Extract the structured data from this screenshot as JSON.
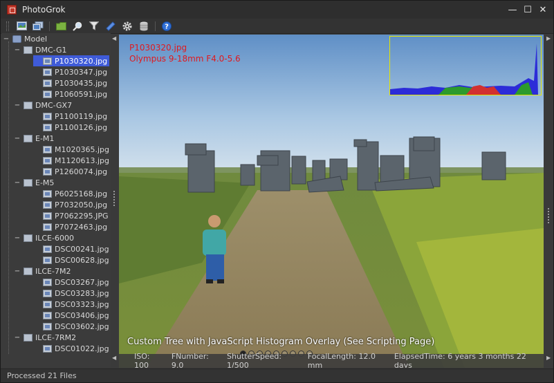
{
  "window": {
    "title": "PhotoGrok",
    "minimize_label": "—",
    "maximize_label": "☐",
    "close_label": "✕"
  },
  "toolbar": {
    "buttons": [
      "open-image",
      "gallery",
      "open-folder",
      "search",
      "filter",
      "tag",
      "settings",
      "database",
      "help"
    ]
  },
  "tree": {
    "root_label": "Model",
    "groups": [
      {
        "label": "DMC-G1",
        "files": [
          "P1030320.jpg",
          "P1030347.jpg",
          "P1030435.jpg",
          "P1060591.jpg"
        ]
      },
      {
        "label": "DMC-GX7",
        "files": [
          "P1100119.jpg",
          "P1100126.jpg"
        ]
      },
      {
        "label": "E-M1",
        "files": [
          "M1020365.jpg",
          "M1120613.jpg",
          "P1260074.jpg"
        ]
      },
      {
        "label": "E-M5",
        "files": [
          "P6025168.jpg",
          "P7032050.jpg",
          "P7062295.JPG",
          "P7072463.jpg"
        ]
      },
      {
        "label": "ILCE-6000",
        "files": [
          "DSC00241.jpg",
          "DSC00628.jpg"
        ]
      },
      {
        "label": "ILCE-7M2",
        "files": [
          "DSC03267.jpg",
          "DSC03283.jpg",
          "DSC03323.jpg",
          "DSC03406.jpg",
          "DSC03602.jpg"
        ]
      },
      {
        "label": "ILCE-7RM2",
        "files": [
          "DSC01022.jpg"
        ]
      }
    ],
    "selected": "P1030320.jpg"
  },
  "viewer": {
    "filename": "P1030320.jpg",
    "lens": "Olympus 9-18mm F4.0-5.6",
    "caption": "Custom Tree with JavaScript Histogram Overlay (See Scripting Page)",
    "exif": {
      "iso": "ISO: 100",
      "fnumber": "FNumber: 9.0",
      "shutter": "ShutterSpeed: 1/500",
      "focal": "FocalLength: 12.0 mm",
      "elapsed": "ElapsedTime: 6 years 3 months 22 days"
    }
  },
  "status": {
    "text": "Processed 21 Files"
  },
  "colors": {
    "selection": "#3f5bd8",
    "overlay_text": "#e0191e",
    "histogram_border": "#e6e600"
  }
}
